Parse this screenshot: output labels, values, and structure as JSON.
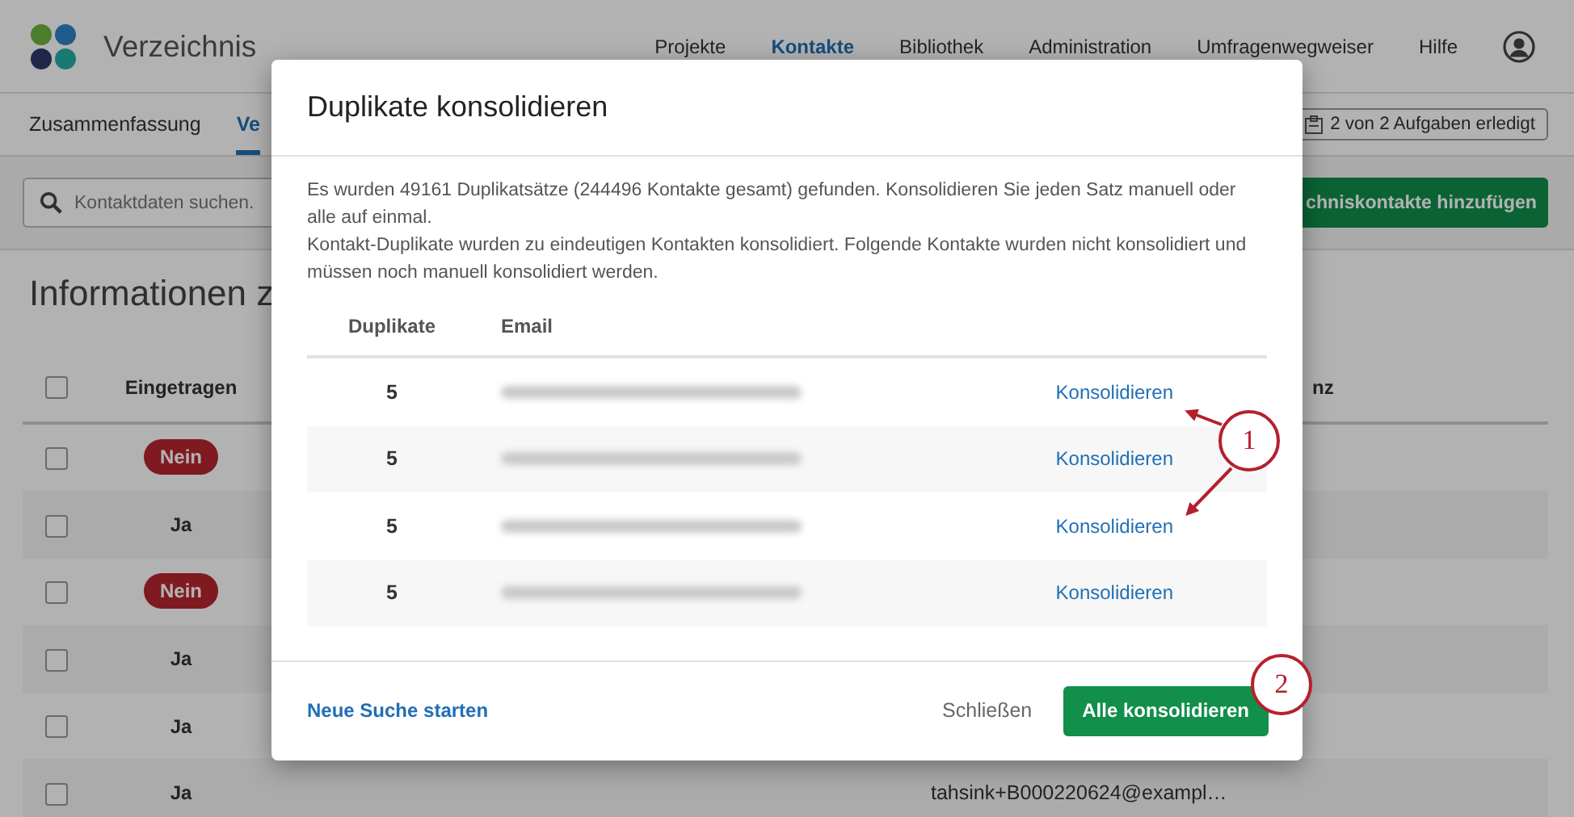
{
  "header": {
    "title": "Verzeichnis",
    "nav": [
      {
        "label": "Projekte",
        "selected": false
      },
      {
        "label": "Kontakte",
        "selected": true
      },
      {
        "label": "Bibliothek",
        "selected": false
      },
      {
        "label": "Administration",
        "selected": false
      },
      {
        "label": "Umfragenwegweiser",
        "selected": false
      },
      {
        "label": "Hilfe",
        "selected": false
      }
    ]
  },
  "subnav": {
    "tabs": [
      {
        "label": "Zusammenfassung",
        "selected": false
      },
      {
        "label": "Ve",
        "selected": true
      }
    ],
    "tasks": "2 von 2 Aufgaben erledigt"
  },
  "toolbar": {
    "search": {
      "placeholder": "Kontaktdaten suchen."
    },
    "add_button": "chniskontakte hinzufügen"
  },
  "heading": "Informationen z",
  "table": {
    "header_checked": false,
    "columns": [
      "Eingetragen",
      "nz"
    ],
    "rows": [
      {
        "checked": false,
        "kind": "badge",
        "registered": "Nein"
      },
      {
        "checked": false,
        "kind": "plain",
        "registered": "Ja"
      },
      {
        "checked": false,
        "kind": "badge",
        "registered": "Nein"
      },
      {
        "checked": false,
        "kind": "plain",
        "registered": "Ja"
      },
      {
        "checked": false,
        "kind": "plain",
        "registered": "Ja"
      },
      {
        "checked": false,
        "kind": "plain",
        "registered": "Ja",
        "email": "tahsink+B000220624@exampl…"
      }
    ]
  },
  "dialog": {
    "title": "Duplikate konsolidieren",
    "paragraphs": [
      "Es wurden 49161 Duplikatsätze (244496 Kontakte gesamt) gefunden. Konsolidieren Sie jeden Satz manuell oder alle auf einmal.",
      "Kontakt-Duplikate wurden zu eindeutigen Kontakten konsolidiert. Folgende Kontakte wurden nicht konsolidiert und müssen noch manuell konsolidiert werden."
    ],
    "columns": [
      "Duplikate",
      "Email"
    ],
    "rows": [
      {
        "count": "5",
        "action": "Konsolidieren"
      },
      {
        "count": "5",
        "action": "Konsolidieren"
      },
      {
        "count": "5",
        "action": "Konsolidieren"
      },
      {
        "count": "5",
        "action": "Konsolidieren"
      }
    ],
    "new_search": "Neue Suche starten",
    "close": "Schließen",
    "consolidate_all": "Alle konsolidieren"
  },
  "callouts": [
    {
      "label": "1"
    },
    {
      "label": "2"
    }
  ]
}
